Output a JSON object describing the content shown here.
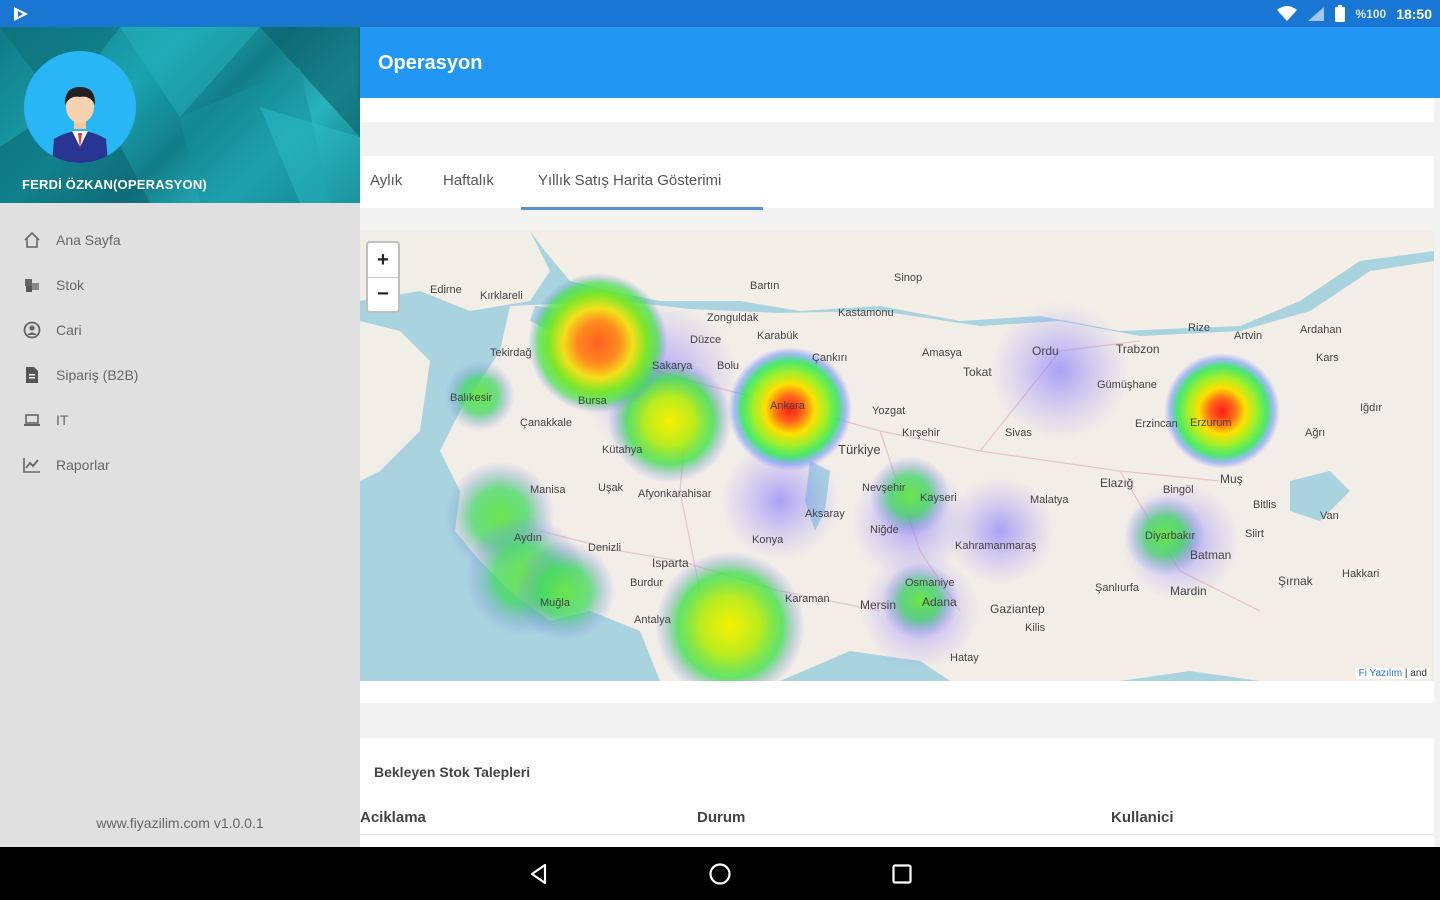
{
  "status_bar": {
    "battery": "%100",
    "time": "18:50",
    "icons": [
      "app-logo-icon",
      "wifi-icon",
      "signal-icon",
      "battery-icon"
    ]
  },
  "drawer": {
    "user_name": "FERDİ ÖZKAN(OPERASYON)",
    "items": [
      {
        "label": "Ana Sayfa",
        "icon": "home-icon"
      },
      {
        "label": "Stok",
        "icon": "cubes-icon"
      },
      {
        "label": "Cari",
        "icon": "user-circle-icon"
      },
      {
        "label": "Sipariş (B2B)",
        "icon": "document-icon"
      },
      {
        "label": "IT",
        "icon": "laptop-icon"
      },
      {
        "label": "Raporlar",
        "icon": "line-chart-icon"
      }
    ],
    "footer": "www.fiyazilim.com v1.0.0.1"
  },
  "toolbar": {
    "title": "Operasyon"
  },
  "tabs": [
    {
      "label": "Aylık",
      "active": false
    },
    {
      "label": "Haftalık",
      "active": false
    },
    {
      "label": "Yıllık Satış Harita Gösterimi",
      "active": true
    }
  ],
  "map": {
    "zoom_in": "+",
    "zoom_out": "−",
    "attribution_link": "Fi Yazılım",
    "attribution_rest": " | and",
    "labels": {
      "edirne": "Edirne",
      "kirklareli": "Kırklareli",
      "tekirdag": "Tekirdağ",
      "sakarya": "Sakarya",
      "zonguldak": "Zonguldak",
      "kastamonu": "Kastamonu",
      "sinop": "Sinop",
      "bartin": "Bartın",
      "karabuk": "Karabük",
      "duzce": "Düzce",
      "bolu": "Bolu",
      "cankiri": "Çankırı",
      "amasya": "Amasya",
      "tokat": "Tokat",
      "ordu": "Ordu",
      "trabzon": "Trabzon",
      "rize": "Rize",
      "artvin": "Artvin",
      "ardahan": "Ardahan",
      "kars": "Kars",
      "gumushane": "Gümüşhane",
      "erzincan": "Erzincan",
      "ankara": "Ankara",
      "yozgat": "Yozgat",
      "kirsehir": "Kırşehir",
      "sivas": "Sivas",
      "turkiye": "Türkiye",
      "nevsehir": "Nevşehir",
      "kayseri": "Kayseri",
      "malatya": "Malatya",
      "elazig": "Elazığ",
      "bingol": "Bingöl",
      "mus": "Muş",
      "bitlis": "Bitlis",
      "van": "Van",
      "aksaray": "Aksaray",
      "nigde": "Niğde",
      "konya": "Konya",
      "kahramanmaras": "Kahramanmaraş",
      "diyarbakir": "Diyarbakır",
      "batman": "Batman",
      "siirt": "Siirt",
      "sirnak": "Şırnak",
      "hakkari": "Hakkari",
      "mardin": "Mardin",
      "sanliurfa": "Şanlıurfa",
      "gaziantep": "Gaziantep",
      "adana": "Adana",
      "mersin": "Mersin",
      "osmaniye": "Osmaniye",
      "karaman": "Karaman",
      "antalya": "Antalya",
      "isparta": "Isparta",
      "afyon": "Afyonkarahisar",
      "usak": "Uşak",
      "kutahya": "Kütahya",
      "aydin": "Aydın",
      "denizli": "Denizli",
      "mugla": "Muğla",
      "manisa": "Manisa",
      "balikesir": "Balıkesir",
      "bursa": "Bursa",
      "burdur": "Burdur",
      "canakkale": "Çanakkale",
      "erzurum": "Erzurum",
      "agri": "Ağrı",
      "igdir": "Iğdır",
      "hatay": "Hatay",
      "kilis": "Kilis"
    }
  },
  "requests": {
    "title": "Bekleyen Stok Talepleri",
    "columns": [
      "Aciklama",
      "Durum",
      "Kullanici"
    ]
  },
  "colors": {
    "status_bar": "#1976d2",
    "toolbar": "#2196f3",
    "tab_underline": "#5b8fd1",
    "drawer_header": "#1ba4b0"
  }
}
